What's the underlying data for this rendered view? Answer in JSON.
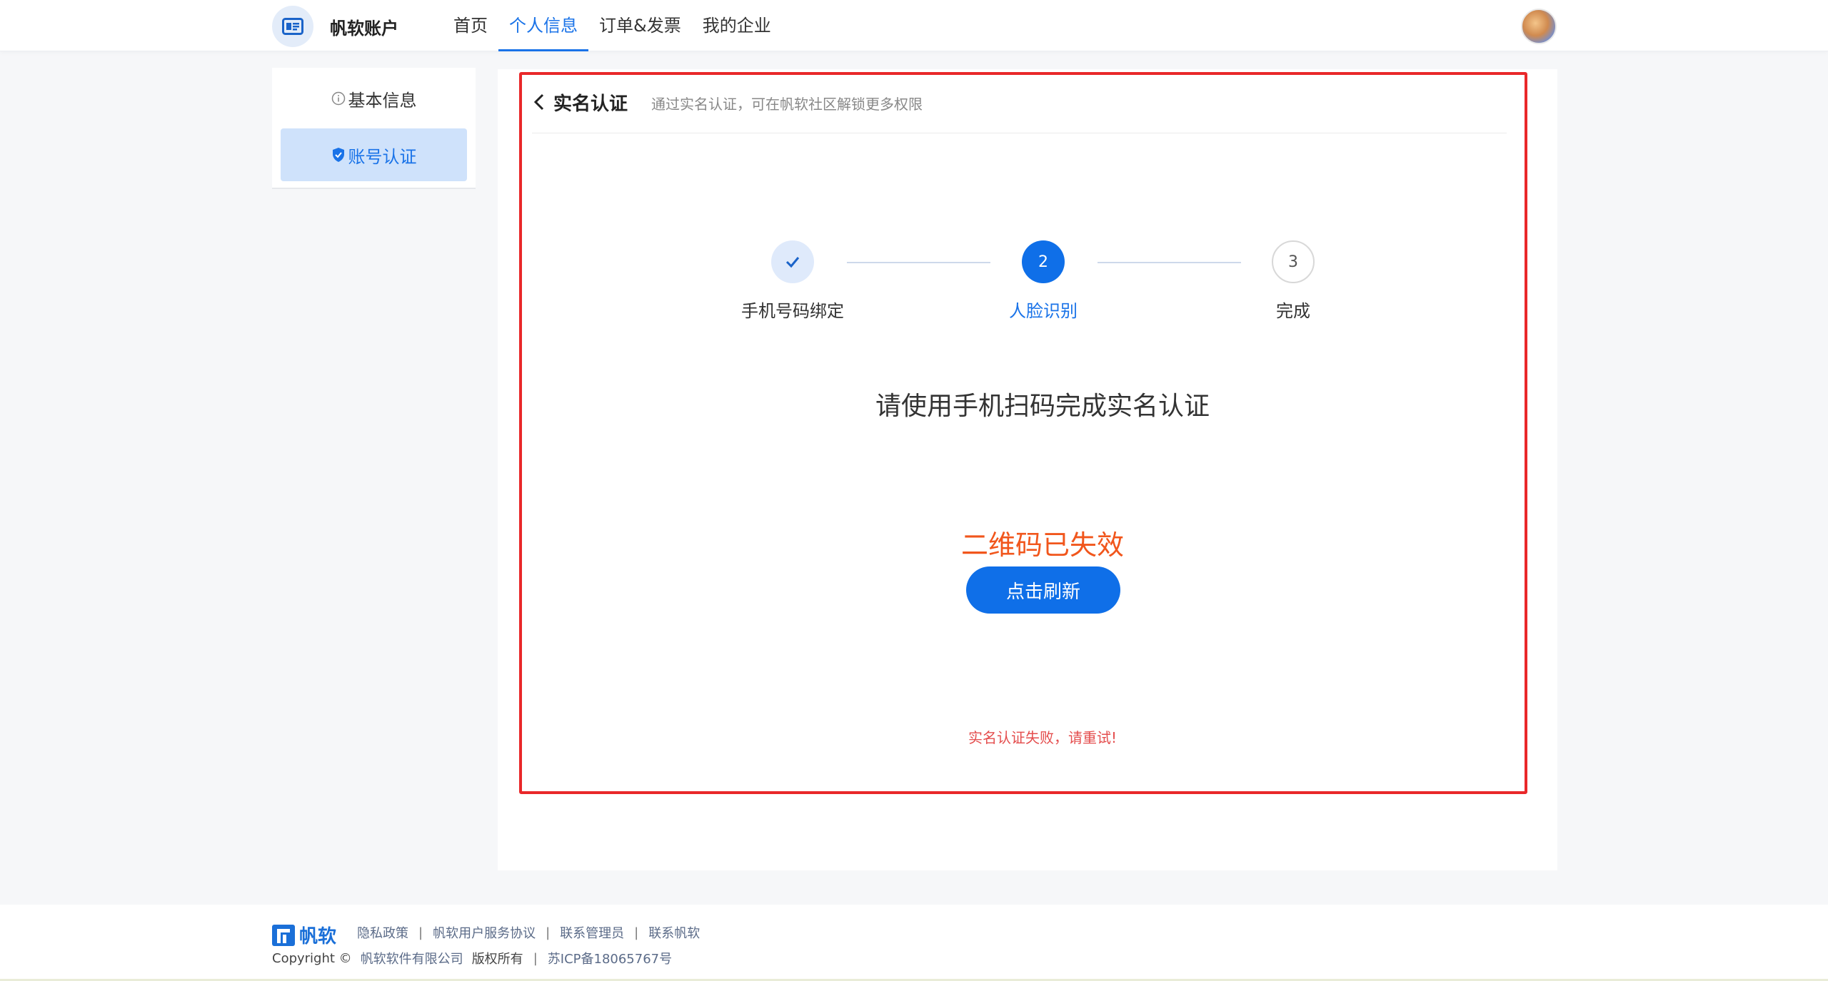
{
  "header": {
    "app_title": "帆软账户",
    "nav": [
      {
        "label": "首页"
      },
      {
        "label": "个人信息",
        "active": true
      },
      {
        "label": "订单&发票"
      },
      {
        "label": "我的企业"
      }
    ]
  },
  "sidebar": {
    "items": [
      {
        "label": "基本信息",
        "icon": "info-icon"
      },
      {
        "label": "账号认证",
        "icon": "shield-check-icon",
        "active": true
      }
    ]
  },
  "panel": {
    "title": "实名认证",
    "subtitle": "通过实名认证，可在帆软社区解锁更多权限",
    "steps": [
      {
        "label": "手机号码绑定",
        "state": "done",
        "mark": "✓"
      },
      {
        "label": "人脸识别",
        "state": "current",
        "mark": "2"
      },
      {
        "label": "完成",
        "state": "pending",
        "mark": "3"
      }
    ],
    "instruction": "请使用手机扫码完成实名认证",
    "qr_status": "二维码已失效",
    "refresh_label": "点击刷新",
    "fail_message": "实名认证失败，请重试!"
  },
  "footer": {
    "logo_text": "帆软",
    "links": [
      "隐私政策",
      "帆软用户服务协议",
      "联系管理员",
      "联系帆软"
    ],
    "copyright_prefix": "Copyright ©",
    "company": "帆软软件有限公司",
    "rights": "版权所有",
    "icp": "苏ICP备18065767号"
  },
  "colors": {
    "primary": "#0f6fe8",
    "warning": "#f1561c",
    "error": "#e44d4d",
    "highlight_frame": "#e9282a"
  }
}
